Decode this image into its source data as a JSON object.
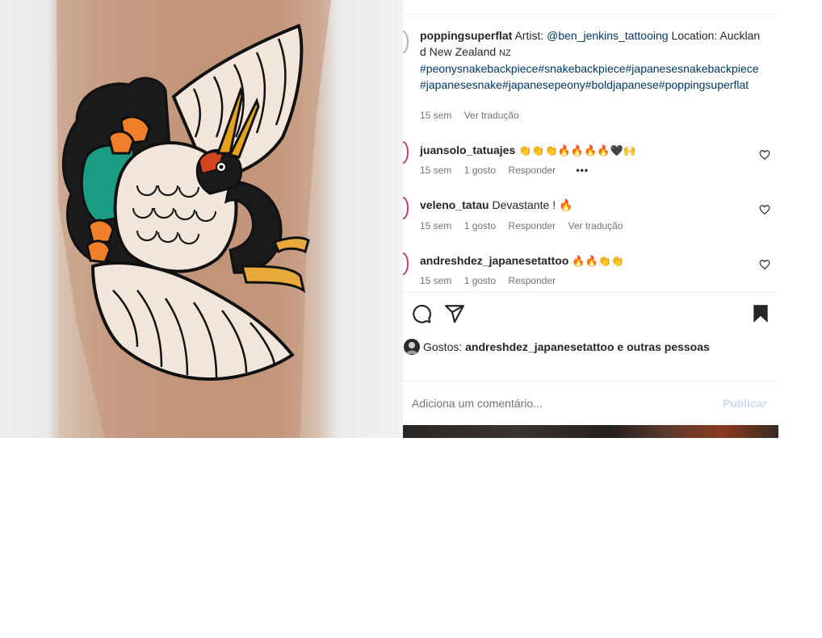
{
  "post": {
    "caption": {
      "username": "poppingsuperflat",
      "text_artist": "Artist:",
      "artist_handle": "@ben_jenkins_tattooing",
      "text_location": "Location:",
      "location": "Auckland New Zealand",
      "country_code": "NZ",
      "hashtags": "#peonysnakebackpiece#snakebackpiece#japanesesnakebackpiece#japanesesnake#japanesepeony#boldjapanese#poppingsuperflat",
      "time": "15 sem",
      "translate": "Ver tradução"
    },
    "comments": [
      {
        "username": "juansolo_tatuajes",
        "text": "👏👏👏🔥🔥🔥🔥🖤🙌",
        "time": "15 sem",
        "likes": "1 gosto",
        "reply": "Responder",
        "more": "•••"
      },
      {
        "username": "veleno_tatau",
        "text": "Devastante ! 🔥",
        "time": "15 sem",
        "likes": "1 gosto",
        "reply": "Responder",
        "translate": "Ver tradução"
      },
      {
        "username": "andreshdez_japanesetattoo",
        "text": "🔥🔥👏👏",
        "time": "15 sem",
        "likes": "1 gosto",
        "reply": "Responder"
      }
    ],
    "actions": {
      "comment_icon": "comment-icon",
      "share_icon": "share-icon",
      "save_icon": "bookmark-icon"
    },
    "likes": {
      "prefix": "Gostos:",
      "liker": "andreshdez_japanesetattoo",
      "suffix": "e outras pessoas"
    },
    "add_comment": {
      "placeholder": "Adiciona um comentário...",
      "publish": "Publicar"
    }
  },
  "colors": {
    "story_ring": "#c13584",
    "link": "#00376b",
    "muted": "#737373",
    "publish_disabled": "#c7dcf5"
  }
}
